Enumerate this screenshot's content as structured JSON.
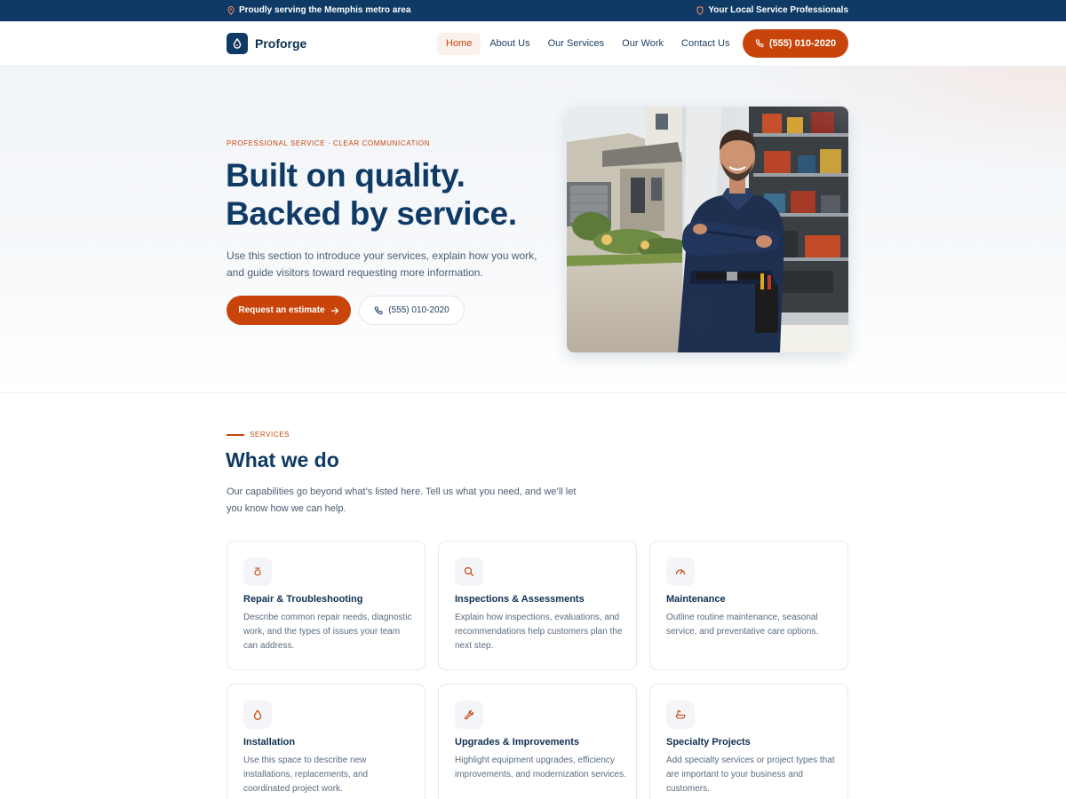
{
  "topbar": {
    "left_text": "Proudly serving the Memphis metro area",
    "right_text": "Your Local Service Professionals"
  },
  "header": {
    "brand": "Proforge",
    "nav": [
      {
        "label": "Home",
        "active": true
      },
      {
        "label": "About Us",
        "active": false
      },
      {
        "label": "Our Services",
        "active": false
      },
      {
        "label": "Our Work",
        "active": false
      },
      {
        "label": "Contact Us",
        "active": false
      }
    ],
    "phone": "(555) 010-2020"
  },
  "hero": {
    "eyebrow": "PROFESSIONAL SERVICE · CLEAR COMMUNICATION",
    "title_line1": "Built on quality.",
    "title_line2": "Backed by service.",
    "text": "Use this section to introduce your services, explain how you work, and guide visitors toward requesting more information.",
    "cta_primary": "Request an estimate",
    "cta_secondary": "(555) 010-2020"
  },
  "services": {
    "eyebrow": "SERVICES",
    "title": "What we do",
    "text": "Our capabilities go beyond what’s listed here. Tell us what you need, and we’ll let you know how we can help.",
    "cards": [
      {
        "icon": "thermometer-icon",
        "title": "Repair & Troubleshooting",
        "text": "Describe common repair needs, diagnostic work, and the types of issues your team can address."
      },
      {
        "icon": "search-icon",
        "title": "Inspections & Assessments",
        "text": "Explain how inspections, evaluations, and recommendations help customers plan the next step."
      },
      {
        "icon": "gauge-icon",
        "title": "Maintenance",
        "text": "Outline routine maintenance, seasonal service, and preventative care options."
      },
      {
        "icon": "droplet-icon",
        "title": "Installation",
        "text": "Use this space to describe new installations, replacements, and coordinated project work."
      },
      {
        "icon": "wrench-icon",
        "title": "Upgrades & Improvements",
        "text": "Highlight equipment upgrades, efficiency improvements, and modernization services."
      },
      {
        "icon": "bathtub-icon",
        "title": "Specialty Projects",
        "text": "Add specialty services or project types that are important to your business and customers."
      }
    ]
  },
  "colors": {
    "brand": "#0f3a66",
    "accent": "#c8440b"
  }
}
